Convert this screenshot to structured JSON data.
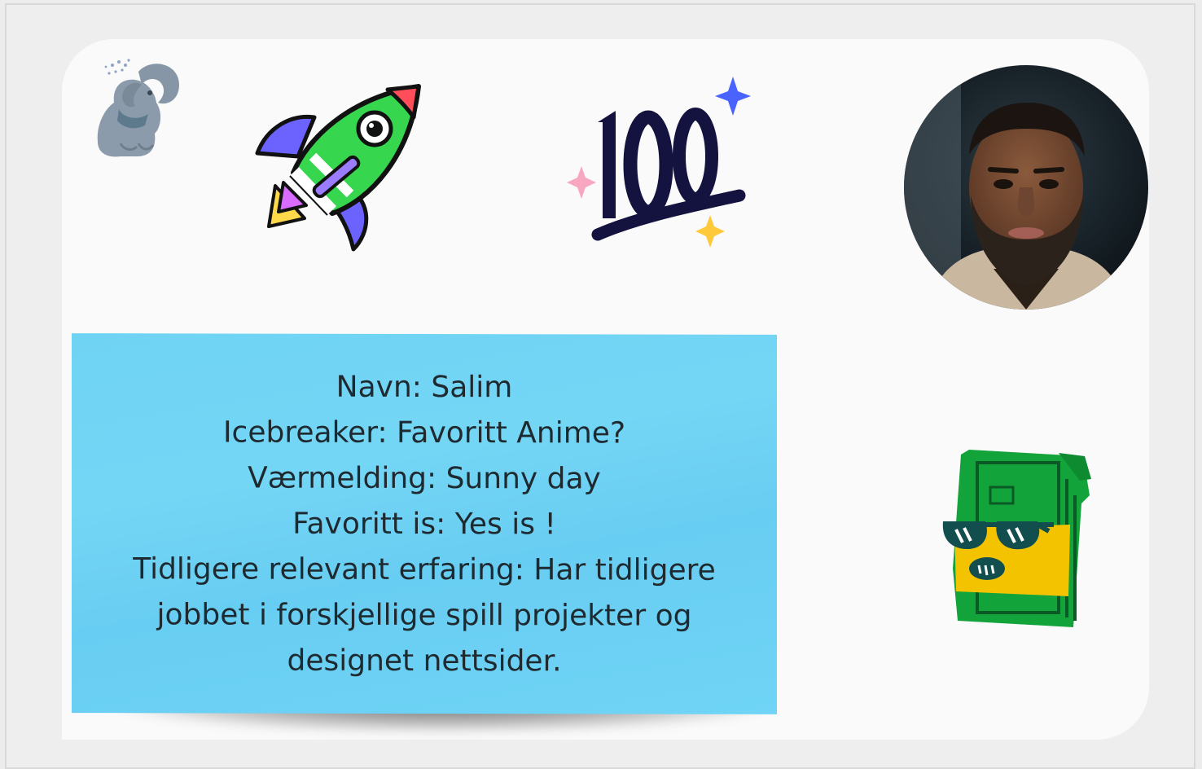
{
  "note": {
    "lines": [
      "Navn: Salim",
      "Icebreaker: Favoritt Anime?",
      "Værmelding: Sunny day",
      "Favoritt is: Yes is !",
      "Tidligere relevant erfaring: Har tidligere",
      "jobbet i forskjellige spill projekter og",
      "designet nettsider."
    ],
    "color": "#6fd3f4"
  },
  "stickers": {
    "elephant": "elephant-sticker-icon",
    "rocket": "rocket-sticker-icon",
    "hundred": "hundred-points-sticker-icon",
    "money": "cool-money-sticker-icon"
  },
  "avatar": {
    "description_name": "profile-photo"
  },
  "colors": {
    "board": "#fafafa",
    "background": "#ececec"
  }
}
